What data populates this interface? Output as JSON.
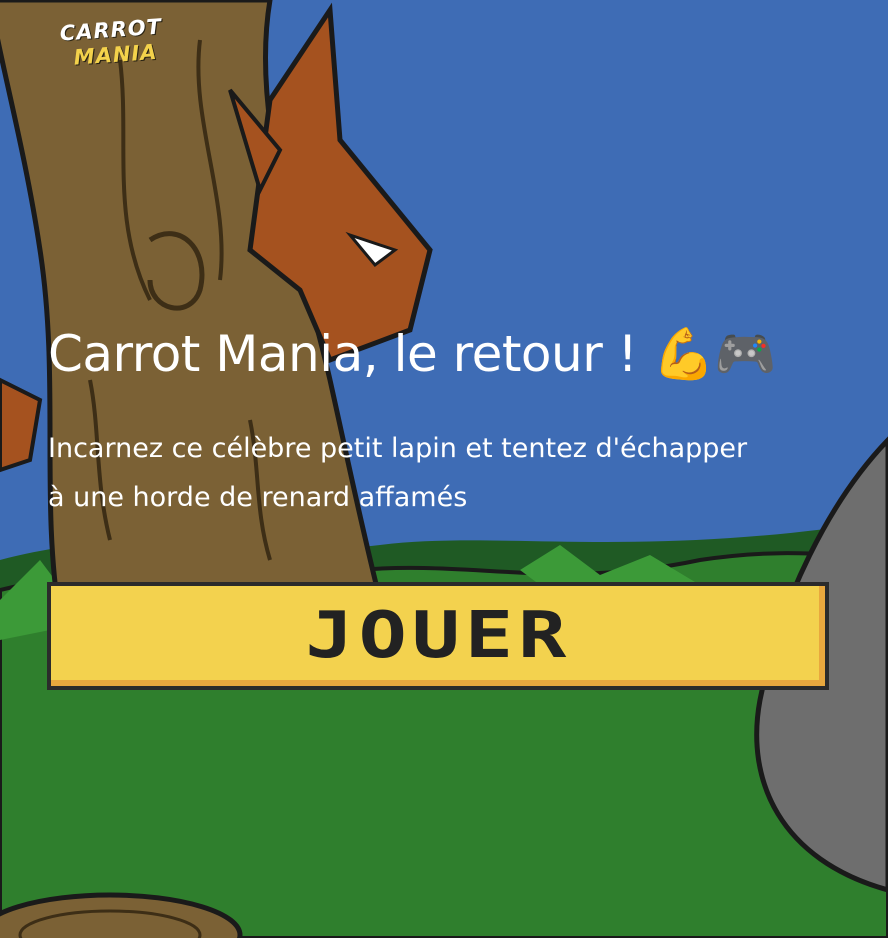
{
  "logo": {
    "line1": "CARROT",
    "line2": "MANIA"
  },
  "hero": {
    "title": "Carrot Mania, le retour ! 💪🎮",
    "subtitle": "Incarnez ce célèbre petit lapin et tentez d'échapper à une horde de renard affamés"
  },
  "play_button": {
    "label": "JOUER"
  },
  "colors": {
    "sky": "#3d6bb3",
    "grass": "#2f7f2d",
    "tree_trunk": "#7b6135",
    "fox": "#a5521f",
    "button_fill": "#f3d24e",
    "button_shadow": "#e8a83e",
    "button_text": "#222222"
  },
  "background": {
    "scene": "cartoon-forest-with-fox-behind-tree"
  }
}
